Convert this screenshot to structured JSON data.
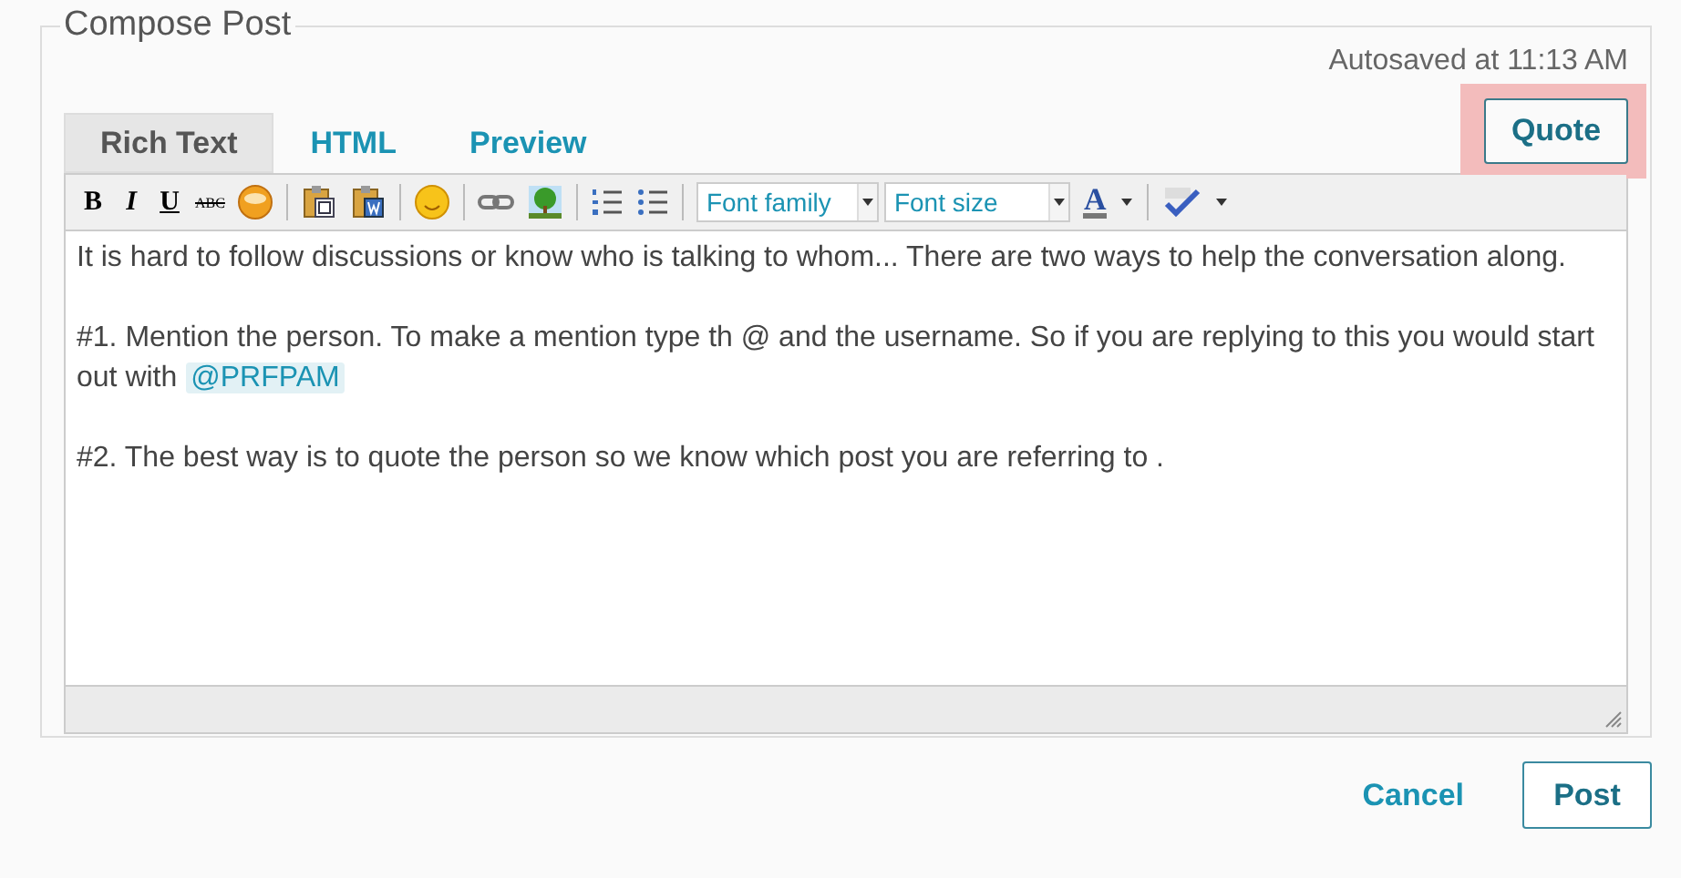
{
  "legend": "Compose Post",
  "autosave": "Autosaved at 11:13 AM",
  "quote_button": {
    "label": "Quote",
    "highlighted": true
  },
  "tabs": [
    {
      "label": "Rich Text",
      "selected": true
    },
    {
      "label": "HTML",
      "selected": false
    },
    {
      "label": "Preview",
      "selected": false
    }
  ],
  "toolbar": {
    "bold": "B",
    "italic": "I",
    "underline": "U",
    "strikethrough": "ABC",
    "font_family": "Font family",
    "font_size": "Font size",
    "text_color": "A"
  },
  "paragraphs": [
    [
      {
        "kind": "text",
        "text": "It is hard to follow discussions or know who is talking to whom... There are two ways to help the conversation along."
      }
    ],
    [
      {
        "kind": "text",
        "text": "#1.  Mention the person. To make a mention type th @ and the username. So if you are replying to this you would start out with "
      },
      {
        "kind": "mention",
        "text": "@PRFPAM"
      }
    ],
    [
      {
        "kind": "text",
        "text": "#2.  The best way is to quote the person so we know which post you are referring to ."
      }
    ]
  ],
  "buttons": {
    "cancel": "Cancel",
    "post": "Post"
  }
}
